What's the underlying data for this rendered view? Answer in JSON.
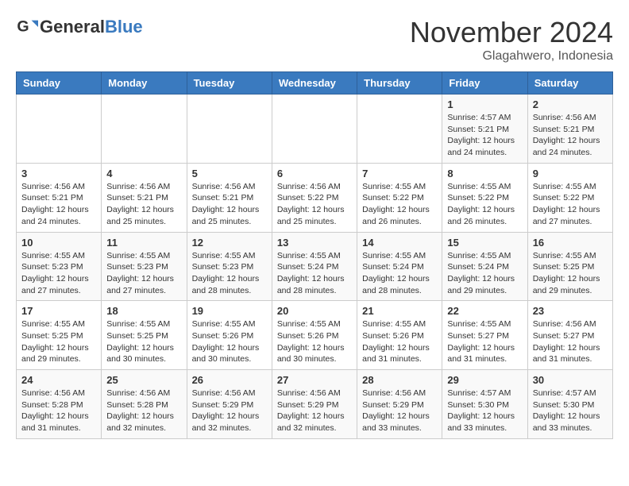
{
  "header": {
    "logo_general": "General",
    "logo_blue": "Blue",
    "month_title": "November 2024",
    "location": "Glagahwero, Indonesia"
  },
  "days_of_week": [
    "Sunday",
    "Monday",
    "Tuesday",
    "Wednesday",
    "Thursday",
    "Friday",
    "Saturday"
  ],
  "weeks": [
    [
      {
        "day": "",
        "info": ""
      },
      {
        "day": "",
        "info": ""
      },
      {
        "day": "",
        "info": ""
      },
      {
        "day": "",
        "info": ""
      },
      {
        "day": "",
        "info": ""
      },
      {
        "day": "1",
        "info": "Sunrise: 4:57 AM\nSunset: 5:21 PM\nDaylight: 12 hours and 24 minutes."
      },
      {
        "day": "2",
        "info": "Sunrise: 4:56 AM\nSunset: 5:21 PM\nDaylight: 12 hours and 24 minutes."
      }
    ],
    [
      {
        "day": "3",
        "info": "Sunrise: 4:56 AM\nSunset: 5:21 PM\nDaylight: 12 hours and 24 minutes."
      },
      {
        "day": "4",
        "info": "Sunrise: 4:56 AM\nSunset: 5:21 PM\nDaylight: 12 hours and 25 minutes."
      },
      {
        "day": "5",
        "info": "Sunrise: 4:56 AM\nSunset: 5:21 PM\nDaylight: 12 hours and 25 minutes."
      },
      {
        "day": "6",
        "info": "Sunrise: 4:56 AM\nSunset: 5:22 PM\nDaylight: 12 hours and 25 minutes."
      },
      {
        "day": "7",
        "info": "Sunrise: 4:55 AM\nSunset: 5:22 PM\nDaylight: 12 hours and 26 minutes."
      },
      {
        "day": "8",
        "info": "Sunrise: 4:55 AM\nSunset: 5:22 PM\nDaylight: 12 hours and 26 minutes."
      },
      {
        "day": "9",
        "info": "Sunrise: 4:55 AM\nSunset: 5:22 PM\nDaylight: 12 hours and 27 minutes."
      }
    ],
    [
      {
        "day": "10",
        "info": "Sunrise: 4:55 AM\nSunset: 5:23 PM\nDaylight: 12 hours and 27 minutes."
      },
      {
        "day": "11",
        "info": "Sunrise: 4:55 AM\nSunset: 5:23 PM\nDaylight: 12 hours and 27 minutes."
      },
      {
        "day": "12",
        "info": "Sunrise: 4:55 AM\nSunset: 5:23 PM\nDaylight: 12 hours and 28 minutes."
      },
      {
        "day": "13",
        "info": "Sunrise: 4:55 AM\nSunset: 5:24 PM\nDaylight: 12 hours and 28 minutes."
      },
      {
        "day": "14",
        "info": "Sunrise: 4:55 AM\nSunset: 5:24 PM\nDaylight: 12 hours and 28 minutes."
      },
      {
        "day": "15",
        "info": "Sunrise: 4:55 AM\nSunset: 5:24 PM\nDaylight: 12 hours and 29 minutes."
      },
      {
        "day": "16",
        "info": "Sunrise: 4:55 AM\nSunset: 5:25 PM\nDaylight: 12 hours and 29 minutes."
      }
    ],
    [
      {
        "day": "17",
        "info": "Sunrise: 4:55 AM\nSunset: 5:25 PM\nDaylight: 12 hours and 29 minutes."
      },
      {
        "day": "18",
        "info": "Sunrise: 4:55 AM\nSunset: 5:25 PM\nDaylight: 12 hours and 30 minutes."
      },
      {
        "day": "19",
        "info": "Sunrise: 4:55 AM\nSunset: 5:26 PM\nDaylight: 12 hours and 30 minutes."
      },
      {
        "day": "20",
        "info": "Sunrise: 4:55 AM\nSunset: 5:26 PM\nDaylight: 12 hours and 30 minutes."
      },
      {
        "day": "21",
        "info": "Sunrise: 4:55 AM\nSunset: 5:26 PM\nDaylight: 12 hours and 31 minutes."
      },
      {
        "day": "22",
        "info": "Sunrise: 4:55 AM\nSunset: 5:27 PM\nDaylight: 12 hours and 31 minutes."
      },
      {
        "day": "23",
        "info": "Sunrise: 4:56 AM\nSunset: 5:27 PM\nDaylight: 12 hours and 31 minutes."
      }
    ],
    [
      {
        "day": "24",
        "info": "Sunrise: 4:56 AM\nSunset: 5:28 PM\nDaylight: 12 hours and 31 minutes."
      },
      {
        "day": "25",
        "info": "Sunrise: 4:56 AM\nSunset: 5:28 PM\nDaylight: 12 hours and 32 minutes."
      },
      {
        "day": "26",
        "info": "Sunrise: 4:56 AM\nSunset: 5:29 PM\nDaylight: 12 hours and 32 minutes."
      },
      {
        "day": "27",
        "info": "Sunrise: 4:56 AM\nSunset: 5:29 PM\nDaylight: 12 hours and 32 minutes."
      },
      {
        "day": "28",
        "info": "Sunrise: 4:56 AM\nSunset: 5:29 PM\nDaylight: 12 hours and 33 minutes."
      },
      {
        "day": "29",
        "info": "Sunrise: 4:57 AM\nSunset: 5:30 PM\nDaylight: 12 hours and 33 minutes."
      },
      {
        "day": "30",
        "info": "Sunrise: 4:57 AM\nSunset: 5:30 PM\nDaylight: 12 hours and 33 minutes."
      }
    ]
  ]
}
